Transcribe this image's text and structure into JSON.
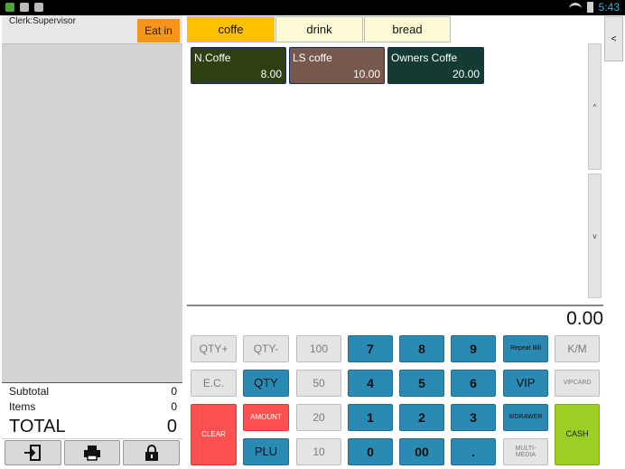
{
  "status_bar": {
    "time": "5:43"
  },
  "header": {
    "clerk_label": "Clerk:Supervisor",
    "order_type_button": "Eat in"
  },
  "tabs": [
    {
      "label": "coffe",
      "active": true
    },
    {
      "label": "drink",
      "active": false
    },
    {
      "label": "bread",
      "active": false
    }
  ],
  "products": [
    {
      "name": "N.Coffe",
      "price": "8.00",
      "color": "#2e4012"
    },
    {
      "name": "LS coffe",
      "price": "10.00",
      "color": "#76584c"
    },
    {
      "name": "Owners Coffe",
      "price": "20.00",
      "color": "#133a33"
    }
  ],
  "side": {
    "collapse_label": "<",
    "scroll_up": "^",
    "scroll_down": "v"
  },
  "display_value": "0.00",
  "totals": {
    "subtotal_label": "Subtotal",
    "subtotal_value": "0",
    "items_label": "Items",
    "items_value": "0",
    "total_label": "TOTAL",
    "total_value": "0"
  },
  "left_buttons": [
    {
      "icon": "logout-icon"
    },
    {
      "icon": "printer-icon"
    },
    {
      "icon": "lock-icon"
    }
  ],
  "keypad": {
    "qty_plus": "QTY+",
    "qty_minus": "QTY-",
    "n100": "100",
    "d7": "7",
    "d8": "8",
    "d9": "9",
    "repeat_bill": "Repeat Bill",
    "km": "K/M",
    "ec": "E.C.",
    "qty": "QTY",
    "n50": "50",
    "d4": "4",
    "d5": "5",
    "d6": "6",
    "vip": "VIP",
    "vipcard": "VIPCARD",
    "clear": "CLEAR",
    "amount": "AMOUNT",
    "n20": "20",
    "d1": "1",
    "d2": "2",
    "d3": "3",
    "drawer": "#/DRAWER",
    "cash": "CASH",
    "plu": "PLU",
    "n10": "10",
    "d0": "0",
    "d00": "00",
    "dot": ".",
    "multimedia": "MULTI-\nMEDIA"
  },
  "colors": {
    "accent_orange": "#f7941d",
    "tab_active": "#ffc000",
    "key_blue": "#2a8ab3",
    "key_red": "#fd5050",
    "key_green": "#9bcf24"
  }
}
